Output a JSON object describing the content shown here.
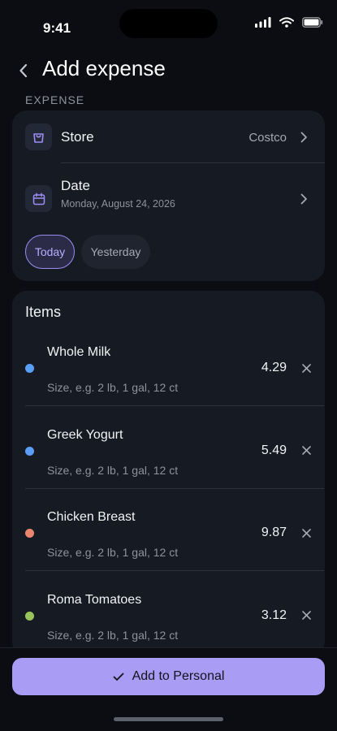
{
  "status": {
    "time": "9:41"
  },
  "header": {
    "title": "Add expense"
  },
  "expense_section": {
    "label": "EXPENSE",
    "store_label": "Store",
    "store_value": "Costco",
    "date_label": "Date",
    "date_value": "Monday, August 24, 2026",
    "chips": [
      "Today",
      "Yesterday"
    ]
  },
  "items_section": {
    "title": "Items",
    "size_placeholder": "Size, e.g. 2 lb, 1 gal, 12 ct",
    "items": [
      {
        "name": "Whole Milk",
        "price": "4.29",
        "color": "#5b9ef5"
      },
      {
        "name": "Greek Yogurt",
        "price": "5.49",
        "color": "#5b9ef5"
      },
      {
        "name": "Chicken Breast",
        "price": "9.87",
        "color": "#ea866c"
      },
      {
        "name": "Roma Tomatoes",
        "price": "3.12",
        "color": "#98c35b"
      }
    ]
  },
  "footer": {
    "button_label": "Add to Personal"
  },
  "colors": {
    "accent": "#a99cf4",
    "background": "#0b0d12",
    "card": "#161a23"
  }
}
